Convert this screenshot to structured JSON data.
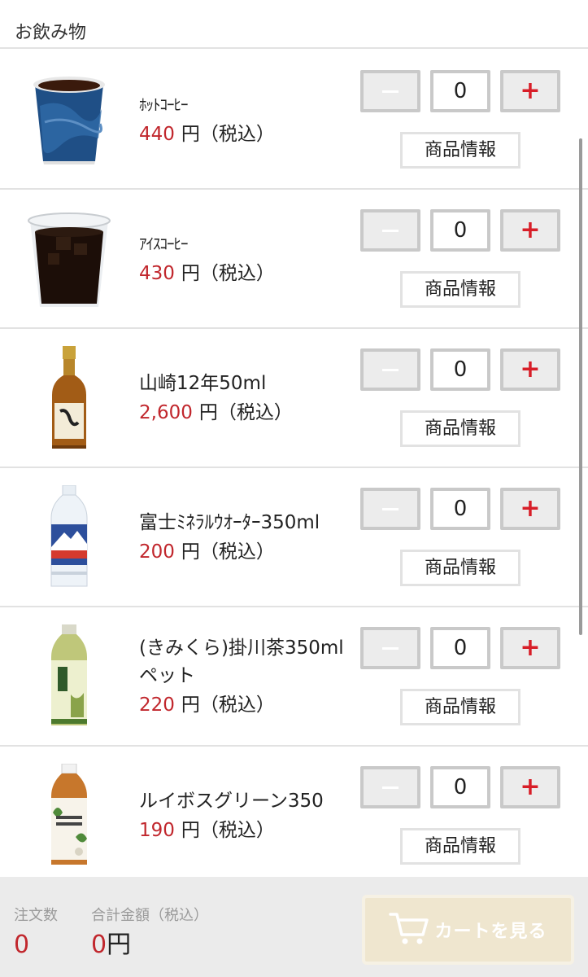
{
  "category": {
    "title": "お飲み物"
  },
  "products": [
    {
      "name": "ﾎｯﾄｺｰﾋｰ",
      "price": "440",
      "price_suffix": "円（税込）",
      "quantity": "0",
      "info_label": "商品情報"
    },
    {
      "name": "ｱｲｽｺｰﾋｰ",
      "price": "430",
      "price_suffix": "円（税込）",
      "quantity": "0",
      "info_label": "商品情報"
    },
    {
      "name": "山崎12年50ml",
      "price": "2,600",
      "price_suffix": "円（税込）",
      "quantity": "0",
      "info_label": "商品情報"
    },
    {
      "name": "富士ﾐﾈﾗﾙｳｵｰﾀｰ350ml",
      "price": "200",
      "price_suffix": "円（税込）",
      "quantity": "0",
      "info_label": "商品情報"
    },
    {
      "name": "(きみくら)掛川茶350mlペット",
      "price": "220",
      "price_suffix": "円（税込）",
      "quantity": "0",
      "info_label": "商品情報"
    },
    {
      "name": "ルイボスグリーン350",
      "price": "190",
      "price_suffix": "円（税込）",
      "quantity": "0",
      "info_label": "商品情報"
    }
  ],
  "qty_controls": {
    "minus_icon": "minus-icon",
    "plus_symbol": "+"
  },
  "footer": {
    "order_count_label": "注文数",
    "order_count": "0",
    "total_label": "合計金額（税込）",
    "total_amount": "0",
    "total_unit": "円",
    "cart_button_label": "カートを見る",
    "cart_icon": "cart-icon"
  },
  "colors": {
    "price_red": "#c1272d",
    "plus_red": "#d81e28",
    "cart_button_bg": "#efe6cf",
    "footer_bg": "#ebebeb"
  }
}
